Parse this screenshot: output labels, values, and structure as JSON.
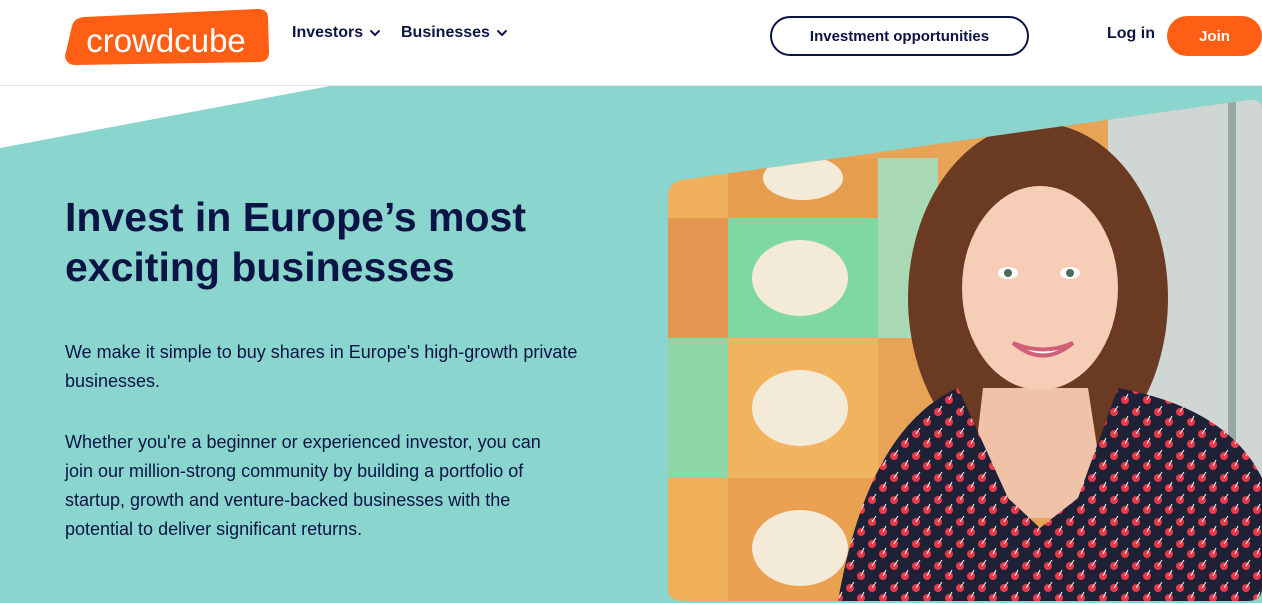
{
  "brand": {
    "name": "crowdcube",
    "logo_color": "#ff5f14"
  },
  "nav": {
    "investors_label": "Investors",
    "businesses_label": "Businesses",
    "investment_opportunities_label": "Investment opportunities",
    "login_label": "Log in",
    "join_label": "Join"
  },
  "hero": {
    "title": "Invest in Europe’s most exciting businesses",
    "paragraph_1": "We make it simple to buy shares in Europe's high-growth private businesses.",
    "paragraph_2": "Whether you're a beginner or experienced investor, you can join our million-strong community by building a portfolio of startup, growth and venture-backed businesses with the potential to deliver significant returns."
  },
  "colors": {
    "accent": "#ff5f14",
    "navy": "#0c1446",
    "hero_background": "#8ad5ce"
  },
  "icons": [
    "chevron-down-icon",
    "crowdcube-logo"
  ]
}
